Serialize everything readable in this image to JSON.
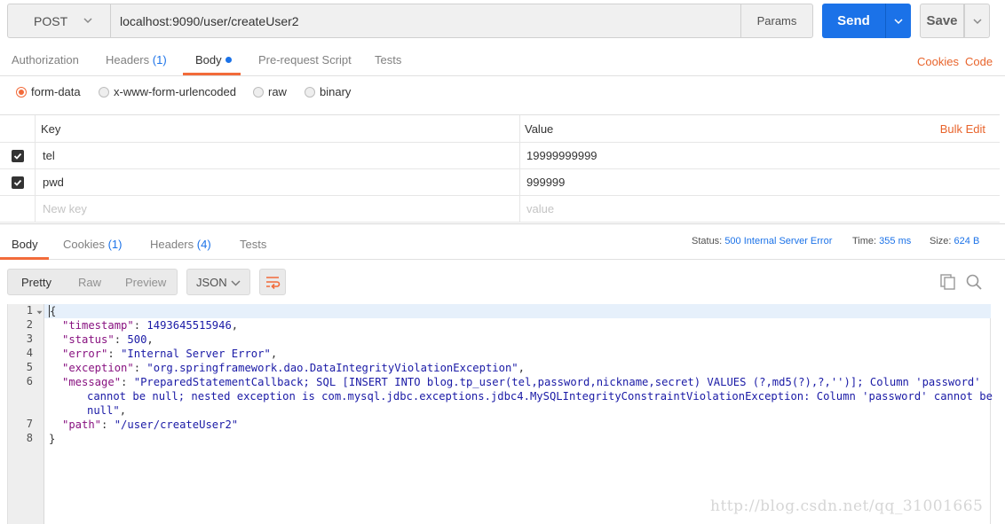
{
  "request": {
    "method": "POST",
    "url": "localhost:9090/user/createUser2",
    "params_label": "Params",
    "send_label": "Send",
    "save_label": "Save"
  },
  "request_tabs": [
    {
      "label": "Authorization",
      "count": ""
    },
    {
      "label": "Headers",
      "count": "(1)"
    },
    {
      "label": "Body",
      "count": ""
    },
    {
      "label": "Pre-request Script",
      "count": ""
    },
    {
      "label": "Tests",
      "count": ""
    }
  ],
  "active_request_tab": "Body",
  "cookies_link": "Cookies",
  "code_link": "Code",
  "body_types": [
    {
      "label": "form-data",
      "selected": true
    },
    {
      "label": "x-www-form-urlencoded",
      "selected": false
    },
    {
      "label": "raw",
      "selected": false
    },
    {
      "label": "binary",
      "selected": false
    }
  ],
  "kv_table": {
    "key_header": "Key",
    "value_header": "Value",
    "bulk_edit": "Bulk Edit",
    "rows": [
      {
        "key": "tel",
        "value": "19999999999",
        "checked": true
      },
      {
        "key": "pwd",
        "value": "999999",
        "checked": true
      }
    ],
    "new_key_placeholder": "New key",
    "new_value_placeholder": "value"
  },
  "response_tabs": [
    {
      "label": "Body",
      "count": ""
    },
    {
      "label": "Cookies",
      "count": "(1)"
    },
    {
      "label": "Headers",
      "count": "(4)"
    },
    {
      "label": "Tests",
      "count": ""
    }
  ],
  "active_response_tab": "Body",
  "response_meta": {
    "status_label": "Status:",
    "status_value": "500 Internal Server Error",
    "time_label": "Time:",
    "time_value": "355 ms",
    "size_label": "Size:",
    "size_value": "624 B"
  },
  "view_modes": [
    "Pretty",
    "Raw",
    "Preview"
  ],
  "active_view_mode": "Pretty",
  "format": "JSON",
  "icons": {
    "wrap": "wrap-lines-icon",
    "copy": "copy-icon",
    "search": "search-icon",
    "chevron": "chevron-down-icon"
  },
  "response_body": {
    "line_numbers": [
      "1",
      "2",
      "3",
      "4",
      "5",
      "6",
      "",
      "",
      "7",
      "8"
    ],
    "open_brace": "{",
    "close_brace": "}",
    "fields": [
      {
        "key": "\"timestamp\"",
        "value": "1493645515946",
        "comma": ","
      },
      {
        "key": "\"status\"",
        "value": "500",
        "comma": ","
      },
      {
        "key": "\"error\"",
        "value": "\"Internal Server Error\"",
        "comma": ","
      },
      {
        "key": "\"exception\"",
        "value": "\"org.springframework.dao.DataIntegrityViolationException\"",
        "comma": ","
      },
      {
        "key": "\"message\"",
        "value": "\"PreparedStatementCallback; SQL [INSERT INTO blog.tp_user(tel,password,nickname,secret) VALUES (?,md5(?),?,'')]; Column 'password'",
        "comma": ""
      },
      {
        "key": "",
        "value": "cannot be null; nested exception is com.mysql.jdbc.exceptions.jdbc4.MySQLIntegrityConstraintViolationException: Column 'password' cannot be",
        "comma": ""
      },
      {
        "key": "",
        "value": "null\"",
        "comma": ","
      },
      {
        "key": "\"path\"",
        "value": "\"/user/createUser2\"",
        "comma": ""
      }
    ]
  },
  "colors": {
    "accent_blue": "#1b72e8",
    "accent_orange": "#f26b3a",
    "json_key": "#881280",
    "json_value": "#1a1aa6"
  },
  "watermark": "http://blog.csdn.net/qq_31001665"
}
